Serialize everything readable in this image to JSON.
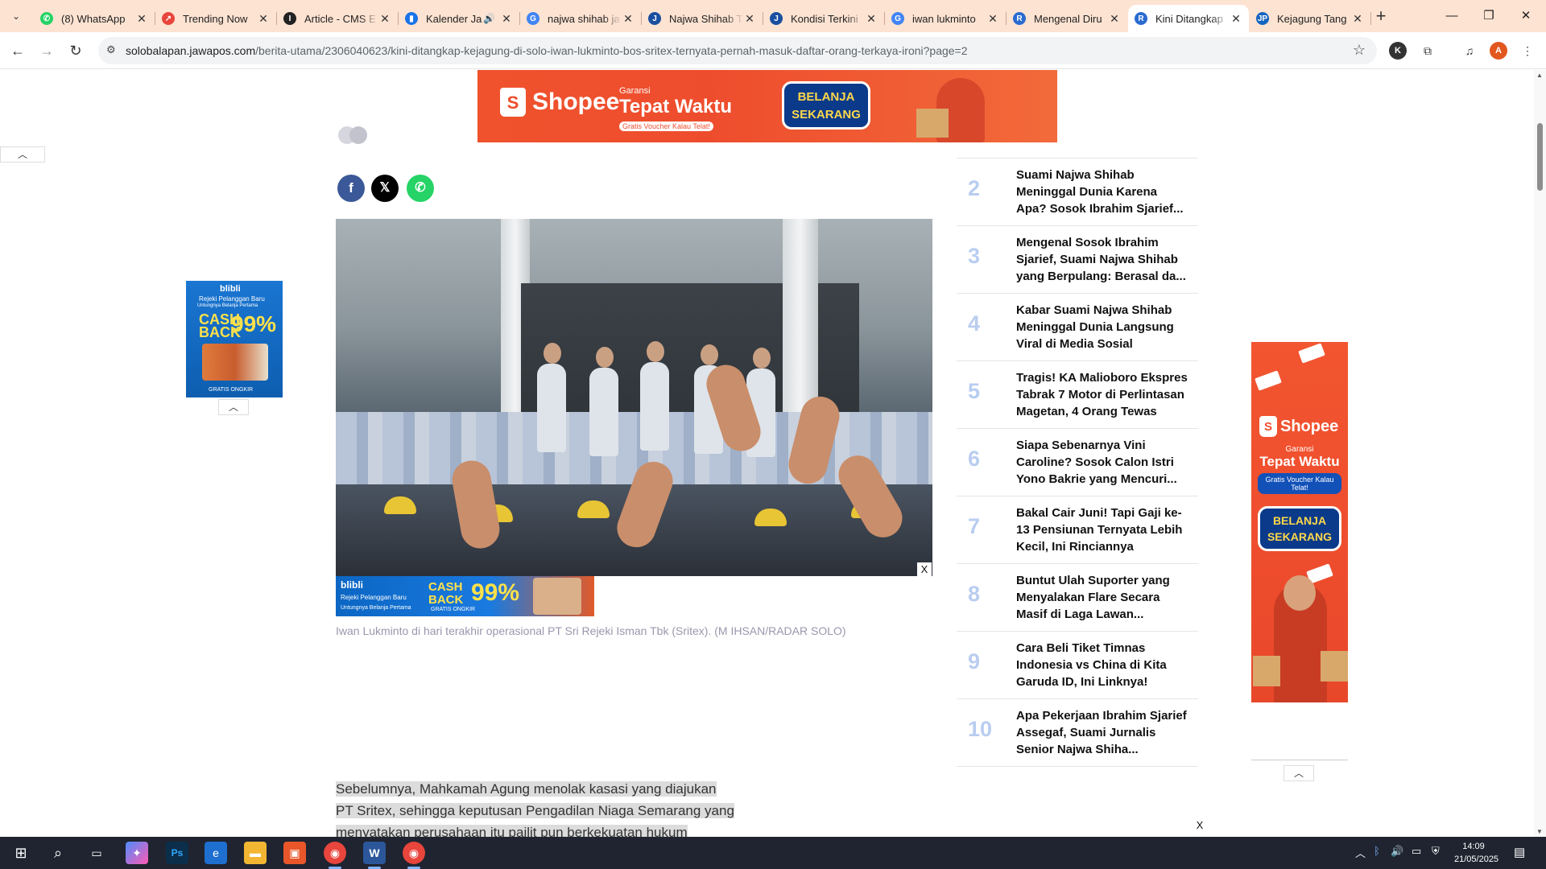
{
  "browser": {
    "tabs": [
      {
        "title": "(8) WhatsApp",
        "icon": "whatsapp-icon",
        "color": "#25d366",
        "glyph": "✆"
      },
      {
        "title": "Trending Now",
        "icon": "trending-icon",
        "color": "#e8453c",
        "glyph": "↗"
      },
      {
        "title": "Article - CMS E",
        "icon": "cms-icon",
        "color": "#222222",
        "glyph": "I"
      },
      {
        "title": "Kalender Ja",
        "icon": "bookmark-icon",
        "color": "#1a73e8",
        "glyph": "▮"
      },
      {
        "title": "najwa shihab ja",
        "icon": "google-icon",
        "color": "#4285f4",
        "glyph": "G"
      },
      {
        "title": "Najwa Shihab T",
        "icon": "jawapos-icon",
        "color": "#1a4fa0",
        "glyph": "J"
      },
      {
        "title": "Kondisi Terkini",
        "icon": "jawapos-icon",
        "color": "#1a4fa0",
        "glyph": "J"
      },
      {
        "title": "iwan lukminto",
        "icon": "google-icon",
        "color": "#4285f4",
        "glyph": "G"
      },
      {
        "title": "Mengenal Diru",
        "icon": "radar-icon",
        "color": "#2a6bd1",
        "glyph": "R"
      },
      {
        "title": "Kini Ditangkap",
        "icon": "radar-icon",
        "color": "#2a6bd1",
        "glyph": "R"
      },
      {
        "title": "Kejagung Tang",
        "icon": "jawapos-icon",
        "color": "#1565c0",
        "glyph": "JP"
      }
    ],
    "url_host": "solobalapan.jawapos.com",
    "url_path": "/berita-utama/2306040623/kini-ditangkap-kejagung-di-solo-iwan-lukminto-bos-sritex-ternyata-pernah-masuk-daftar-orang-terkaya-ironi?page=2",
    "profile_k": "K",
    "profile_a": "A"
  },
  "ads": {
    "top": {
      "brand": "Shopee",
      "guarantee_small": "Garansi",
      "guarantee_big": "Tepat Waktu",
      "voucher": "Gratis Voucher Kalau Telat!",
      "cta_line1": "BELANJA",
      "cta_line2": "SEKARANG"
    },
    "blibli": {
      "brand": "blibli",
      "promo": "Rejeki Pelanggan Baru",
      "sub": "Untungnya Belanja Pertama",
      "cashback_line1": "CASH",
      "cashback_line2": "BACK",
      "percent": "99%",
      "shipping": "GRATIS ONGKIR"
    },
    "close_label": "X",
    "right": {
      "brand": "Shopee",
      "guarantee_small": "Garansi",
      "guarantee_big": "Tepat Waktu",
      "voucher": "Gratis Voucher Kalau Telat!",
      "cta_line1": "BELANJA",
      "cta_line2": "SEKARANG"
    }
  },
  "article": {
    "caption": "Iwan Lukminto di hari terakhir operasional PT Sri Rejeki Isman Tbk (Sritex). (M IHSAN/RADAR SOLO)",
    "paragraph_line1": "Sebelumnya, Mahkamah Agung menolak kasasi yang diajukan",
    "paragraph_line2": "PT Sritex, sehingga keputusan Pengadilan Niaga Semarang yang",
    "paragraph_line3": "menyatakan perusahaan itu pailit pun berkekuatan hukum"
  },
  "trending": [
    {
      "num": "2",
      "title": "Suami Najwa Shihab Meninggal Dunia Karena Apa? Sosok Ibrahim Sjarief..."
    },
    {
      "num": "3",
      "title": "Mengenal Sosok Ibrahim Sjarief, Suami Najwa Shihab yang Berpulang: Berasal da..."
    },
    {
      "num": "4",
      "title": "Kabar Suami Najwa Shihab Meninggal Dunia Langsung Viral di Media Sosial"
    },
    {
      "num": "5",
      "title": "Tragis! KA Malioboro Ekspres Tabrak 7 Motor di Perlintasan Magetan, 4 Orang Tewas"
    },
    {
      "num": "6",
      "title": "Siapa Sebenarnya Vini Caroline? Sosok Calon Istri Yono Bakrie yang Mencuri..."
    },
    {
      "num": "7",
      "title": "Bakal Cair Juni! Tapi Gaji ke-13 Pensiunan Ternyata Lebih Kecil, Ini Rinciannya"
    },
    {
      "num": "8",
      "title": "Buntut Ulah Suporter yang Menyalakan Flare Secara Masif di Laga Lawan..."
    },
    {
      "num": "9",
      "title": "Cara Beli Tiket Timnas Indonesia vs China di Kita Garuda ID, Ini Linknya!"
    },
    {
      "num": "10",
      "title": "Apa Pekerjaan Ibrahim Sjarief Assegaf, Suami Jurnalis Senior Najwa Shiha..."
    }
  ],
  "taskbar": {
    "time": "14:09",
    "date": "21/05/2025"
  }
}
